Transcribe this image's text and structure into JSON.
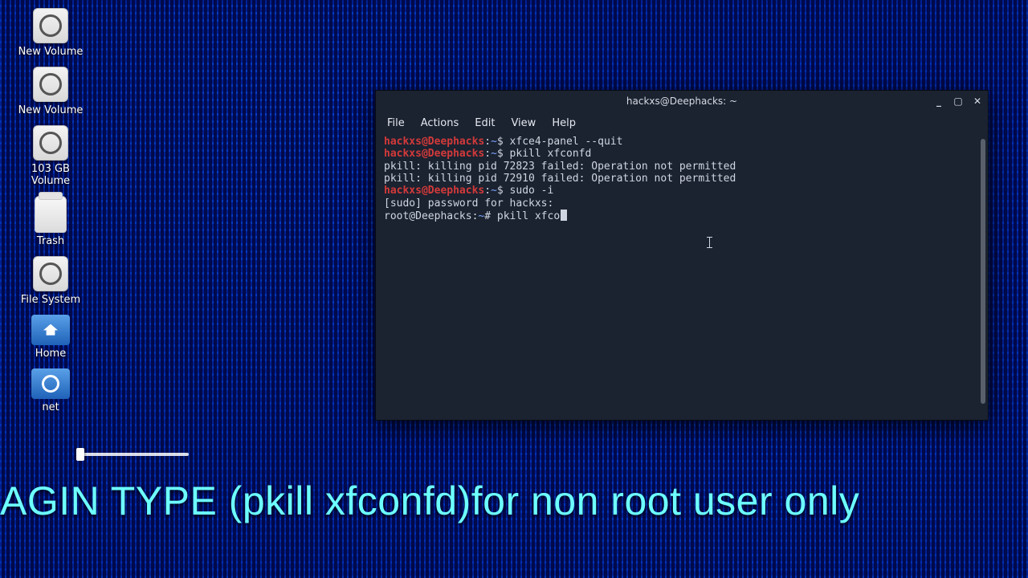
{
  "desktop_icons": [
    {
      "id": "vol1",
      "type": "drive",
      "label": "New Volume"
    },
    {
      "id": "vol2",
      "type": "drive",
      "label": "New Volume"
    },
    {
      "id": "vol3",
      "type": "drive",
      "label": "103 GB Volume"
    },
    {
      "id": "trash",
      "type": "trash",
      "label": "Trash"
    },
    {
      "id": "fs",
      "type": "drive",
      "label": "File System"
    },
    {
      "id": "home",
      "type": "folder-home",
      "label": "Home"
    },
    {
      "id": "net",
      "type": "folder-net",
      "label": "net"
    }
  ],
  "window": {
    "title": "hackxs@Deephacks: ~",
    "controls": {
      "min": "_",
      "max": "▢",
      "close": "✕"
    },
    "menu": [
      "File",
      "Actions",
      "Edit",
      "View",
      "Help"
    ]
  },
  "terminal": {
    "prompt_user": "hackxs@Deephacks",
    "prompt_path": "~",
    "root_prompt": "root@Deephacks",
    "lines": {
      "cmd1": "xfce4-panel --quit",
      "cmd2": "pkill xfconfd",
      "err1": "pkill: killing pid 72823 failed: Operation not permitted",
      "err2": "pkill: killing pid 72910 failed: Operation not permitted",
      "cmd3": "sudo -i",
      "sudo": "[sudo] password for hackxs:",
      "cmd4": "pkill xfco"
    }
  },
  "caption": "AGIN TYPE (pkill xfconfd)for non root user only"
}
